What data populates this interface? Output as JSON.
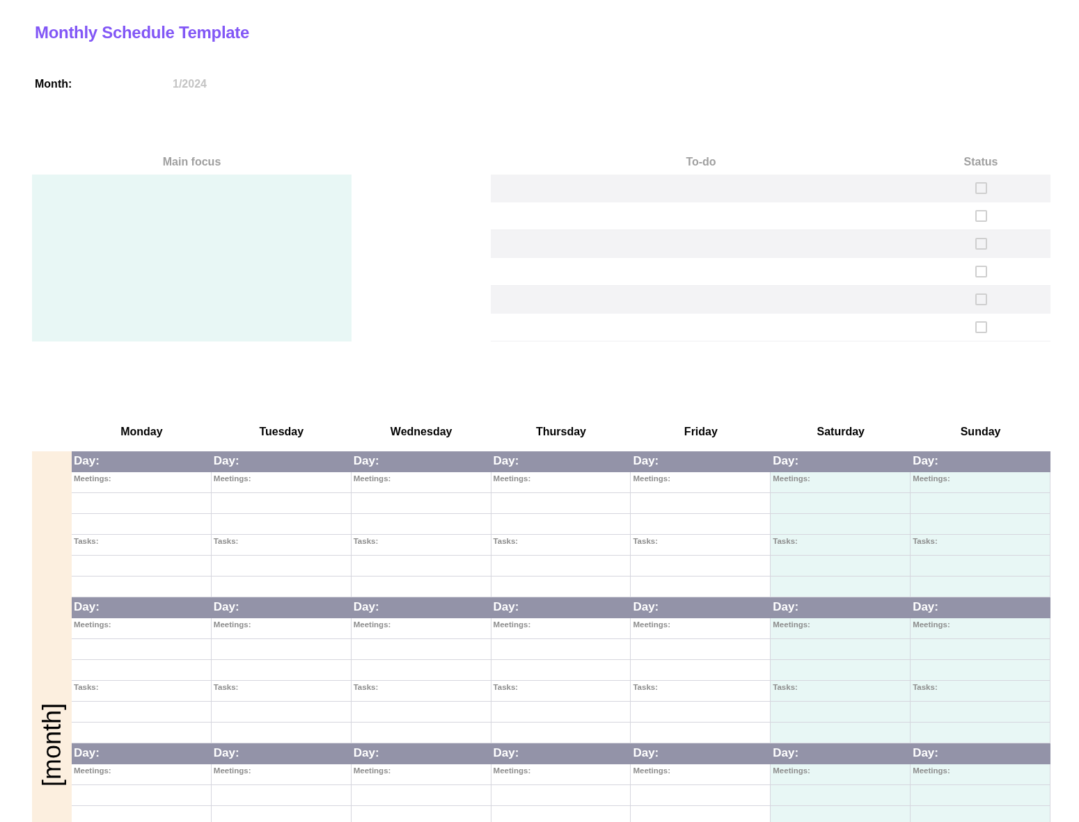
{
  "title": "Monthly Schedule Template",
  "month": {
    "label": "Month:",
    "value": "1/2024"
  },
  "main_focus": {
    "heading": "Main focus"
  },
  "todo": {
    "heading": "To-do",
    "status_heading": "Status",
    "rows": [
      {
        "checked": false
      },
      {
        "checked": false
      },
      {
        "checked": false
      },
      {
        "checked": false
      },
      {
        "checked": false
      },
      {
        "checked": false
      }
    ]
  },
  "calendar": {
    "side_label": "[month]",
    "weekdays": [
      "Monday",
      "Tuesday",
      "Wednesday",
      "Thursday",
      "Friday",
      "Saturday",
      "Sunday"
    ],
    "weeks": [
      {
        "days": [
          {
            "day_label": "Day:",
            "meetings_label": "Meetings:",
            "tasks_label": "Tasks:",
            "weekend": false
          },
          {
            "day_label": "Day:",
            "meetings_label": "Meetings:",
            "tasks_label": "Tasks:",
            "weekend": false
          },
          {
            "day_label": "Day:",
            "meetings_label": "Meetings:",
            "tasks_label": "Tasks:",
            "weekend": false
          },
          {
            "day_label": "Day:",
            "meetings_label": "Meetings:",
            "tasks_label": "Tasks:",
            "weekend": false
          },
          {
            "day_label": "Day:",
            "meetings_label": "Meetings:",
            "tasks_label": "Tasks:",
            "weekend": false
          },
          {
            "day_label": "Day:",
            "meetings_label": "Meetings:",
            "tasks_label": "Tasks:",
            "weekend": true
          },
          {
            "day_label": "Day:",
            "meetings_label": "Meetings:",
            "tasks_label": "Tasks:",
            "weekend": true
          }
        ]
      },
      {
        "days": [
          {
            "day_label": "Day:",
            "meetings_label": "Meetings:",
            "tasks_label": "Tasks:",
            "weekend": false
          },
          {
            "day_label": "Day:",
            "meetings_label": "Meetings:",
            "tasks_label": "Tasks:",
            "weekend": false
          },
          {
            "day_label": "Day:",
            "meetings_label": "Meetings:",
            "tasks_label": "Tasks:",
            "weekend": false
          },
          {
            "day_label": "Day:",
            "meetings_label": "Meetings:",
            "tasks_label": "Tasks:",
            "weekend": false
          },
          {
            "day_label": "Day:",
            "meetings_label": "Meetings:",
            "tasks_label": "Tasks:",
            "weekend": false
          },
          {
            "day_label": "Day:",
            "meetings_label": "Meetings:",
            "tasks_label": "Tasks:",
            "weekend": true
          },
          {
            "day_label": "Day:",
            "meetings_label": "Meetings:",
            "tasks_label": "Tasks:",
            "weekend": true
          }
        ]
      },
      {
        "days": [
          {
            "day_label": "Day:",
            "meetings_label": "Meetings:",
            "weekend": false
          },
          {
            "day_label": "Day:",
            "meetings_label": "Meetings:",
            "weekend": false
          },
          {
            "day_label": "Day:",
            "meetings_label": "Meetings:",
            "weekend": false
          },
          {
            "day_label": "Day:",
            "meetings_label": "Meetings:",
            "weekend": false
          },
          {
            "day_label": "Day:",
            "meetings_label": "Meetings:",
            "weekend": false
          },
          {
            "day_label": "Day:",
            "meetings_label": "Meetings:",
            "weekend": true
          },
          {
            "day_label": "Day:",
            "meetings_label": "Meetings:",
            "weekend": true
          }
        ]
      }
    ]
  }
}
